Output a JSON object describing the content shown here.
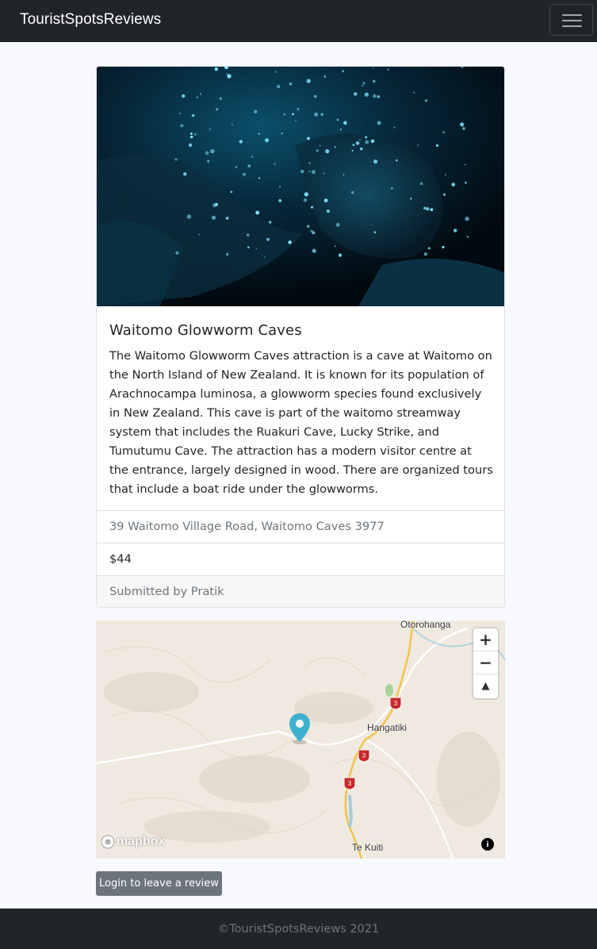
{
  "navbar": {
    "brand": "TouristSpotsReviews"
  },
  "spot": {
    "title": "Waitomo Glowworm Caves",
    "description": "The Waitomo Glowworm Caves attraction is a cave at Waitomo on the North Island of New Zealand. It is known for its population of Arachnocampa luminosa, a glowworm species found exclusively in New Zealand. This cave is part of the waitomo streamway system that includes the Ruakuri Cave, Lucky Strike, and Tumutumu Cave. The attraction has a modern visitor centre at the entrance, largely designed in wood. There are organized tours that include a boat ride under the glowworms.",
    "address": "39 Waitomo Village Road, Waitomo Caves 3977",
    "price": "$44",
    "submitted_by": "Submitted by Pratik"
  },
  "map": {
    "labels": {
      "otorohanga": "Otorohanga",
      "hangatiki": "Hangatiki",
      "te_kuiti": "Te Kuiti"
    },
    "route_shield": "3",
    "zoom_in": "+",
    "zoom_out": "−",
    "compass": "▲",
    "logo": "mapbox",
    "info": "i",
    "marker_color": "#3fb1ce"
  },
  "actions": {
    "login_label": "Login to leave a review"
  },
  "footer": {
    "copyright": "©TouristSpotsReviews 2021"
  }
}
